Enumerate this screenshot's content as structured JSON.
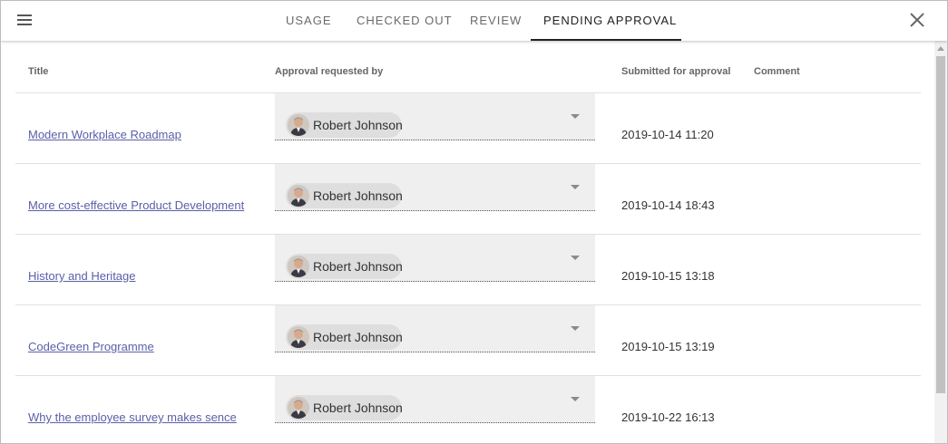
{
  "tabs": [
    {
      "label": "USAGE"
    },
    {
      "label": "CHECKED OUT"
    },
    {
      "label": "REVIEW"
    },
    {
      "label": "PENDING APPROVAL"
    }
  ],
  "active_tab": "PENDING APPROVAL",
  "icons": {
    "menu": "hamburger-menu-icon",
    "close": "close-icon",
    "dropdown": "dropdown-arrow-icon",
    "avatar": "user-avatar"
  },
  "table": {
    "columns": [
      "Title",
      "Approval requested by",
      "Submitted for approval",
      "Comment"
    ],
    "rows": [
      {
        "title": "Modern Workplace Roadmap",
        "requester": "Robert Johnson",
        "submitted": "2019-10-14 11:20",
        "comment": ""
      },
      {
        "title": "More cost-effective Product Development",
        "requester": "Robert Johnson",
        "submitted": "2019-10-14 18:43",
        "comment": ""
      },
      {
        "title": "History and Heritage",
        "requester": "Robert Johnson",
        "submitted": "2019-10-15 13:18",
        "comment": ""
      },
      {
        "title": "CodeGreen Programme",
        "requester": "Robert Johnson",
        "submitted": "2019-10-15 13:19",
        "comment": ""
      },
      {
        "title": "Why the employee survey makes sence",
        "requester": "Robert Johnson",
        "submitted": "2019-10-22 16:13",
        "comment": ""
      }
    ]
  },
  "colors": {
    "link": "#5a5fa8",
    "active_tab": "#212121",
    "inactive_tab": "#6a6a6a",
    "picker_bg": "#efefef",
    "chip_bg": "#dedede"
  }
}
